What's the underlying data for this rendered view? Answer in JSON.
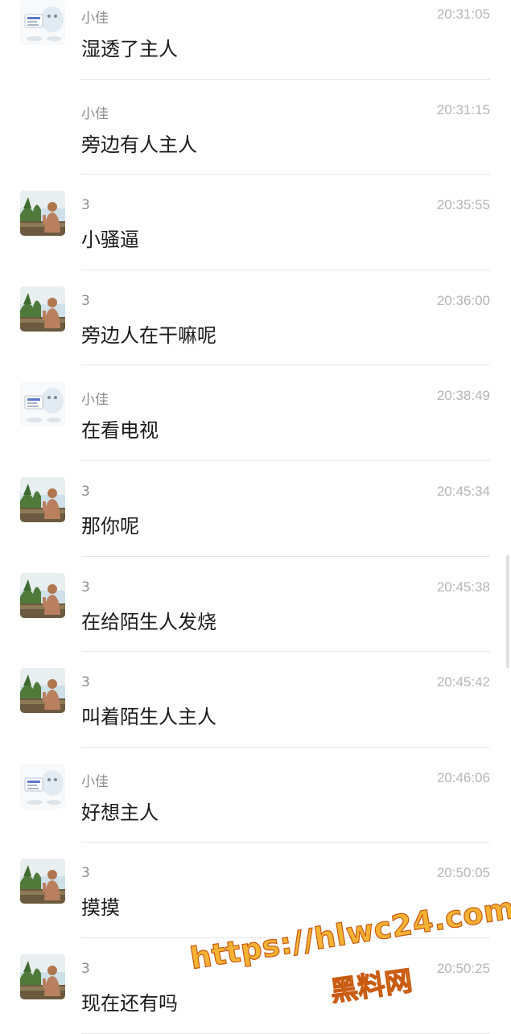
{
  "messages": [
    {
      "sender": "小佳",
      "time": "20:31:05",
      "text": "湿透了主人",
      "avatar": "xiaojia-avatar"
    },
    {
      "sender": "小佳",
      "time": "20:31:15",
      "text": "旁边有人主人",
      "avatar": "none"
    },
    {
      "sender": "3",
      "time": "20:35:55",
      "text": "小骚逼",
      "avatar": "user3-avatar"
    },
    {
      "sender": "3",
      "time": "20:36:00",
      "text": "旁边人在干嘛呢",
      "avatar": "user3-avatar"
    },
    {
      "sender": "小佳",
      "time": "20:38:49",
      "text": "在看电视",
      "avatar": "xiaojia-avatar"
    },
    {
      "sender": "3",
      "time": "20:45:34",
      "text": "那你呢",
      "avatar": "user3-avatar"
    },
    {
      "sender": "3",
      "time": "20:45:38",
      "text": "在给陌生人发烧",
      "avatar": "user3-avatar"
    },
    {
      "sender": "3",
      "time": "20:45:42",
      "text": "叫着陌生人主人",
      "avatar": "user3-avatar"
    },
    {
      "sender": "小佳",
      "time": "20:46:06",
      "text": "好想主人",
      "avatar": "xiaojia-avatar"
    },
    {
      "sender": "3",
      "time": "20:50:05",
      "text": "摸摸",
      "avatar": "user3-avatar"
    },
    {
      "sender": "3",
      "time": "20:50:25",
      "text": "现在还有吗",
      "avatar": "user3-avatar"
    }
  ],
  "watermark": {
    "url": "https://hlwc24.com",
    "subtitle": "黑料网"
  },
  "colors": {
    "background": "#ffffff",
    "sender": "#8c8c8c",
    "time": "#b5b5b5",
    "message": "#1a1a1a",
    "divider": "#e6e6e6",
    "watermark_fill": "#f5b333",
    "watermark_stroke": "#c85a12"
  }
}
